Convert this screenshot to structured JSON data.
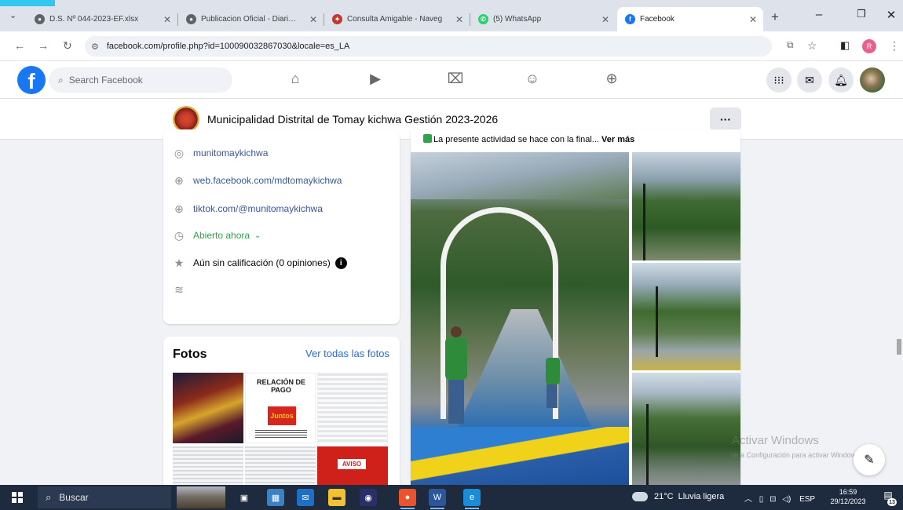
{
  "browser": {
    "tabs": [
      {
        "title": "D.S. Nº 044-2023-EF.xlsx",
        "active": false
      },
      {
        "title": "Publicacion Oficial - Diario C",
        "active": false
      },
      {
        "title": "Consulta Amigable - Naveg",
        "active": false
      },
      {
        "title": "(5) WhatsApp",
        "active": false
      },
      {
        "title": "Facebook",
        "active": true
      }
    ],
    "url": {
      "host": "facebook.com",
      "path": "/profile.php?id=100090032867030&locale=es_LA"
    },
    "profile_initial": "R"
  },
  "facebook": {
    "logo": "f",
    "search_placeholder": "Search Facebook",
    "nav_icons": [
      "home-icon",
      "watch-icon",
      "marketplace-icon",
      "groups-icon",
      "gaming-icon"
    ],
    "right_icons": [
      "menu-grid-icon",
      "messenger-icon",
      "notifications-icon",
      "profile-avatar"
    ]
  },
  "page": {
    "name": "Municipalidad Distrital de Tomay kichwa Gestión 2023-2026",
    "more_label": "···"
  },
  "intro": {
    "instagram": "munitomaykichwa",
    "website": "web.facebook.com/mdtomaykichwa",
    "tiktok": "tiktok.com/@munitomaykichwa",
    "hours": "Abierto ahora",
    "rating": "Aún sin calificación (0 opiniones)"
  },
  "photos": {
    "title": "Fotos",
    "see_all": "Ver todas las fotos",
    "thumb_payment_title": "RELACIÓN DE PAGO",
    "thumb_payment_sub": "Juntos",
    "thumb_notice": "AVISO"
  },
  "post": {
    "text": "La presente actividad se hace con la final...",
    "see_more": "Ver más"
  },
  "watermark": {
    "title": "Activar Windows",
    "subtitle": "Ve a Configuración para activar Windows."
  },
  "taskbar": {
    "search_label": "Buscar",
    "weather_temp": "21°C",
    "weather_desc": "Lluvia ligera",
    "lang": "ESP",
    "time": "16:59",
    "date": "29/12/2023",
    "notification_count": "13"
  },
  "colors": {
    "facebook_blue": "#1877f2",
    "link_blue": "#385898",
    "open_green": "#31a24c",
    "taskbar_bg": "#1e2b3f"
  }
}
